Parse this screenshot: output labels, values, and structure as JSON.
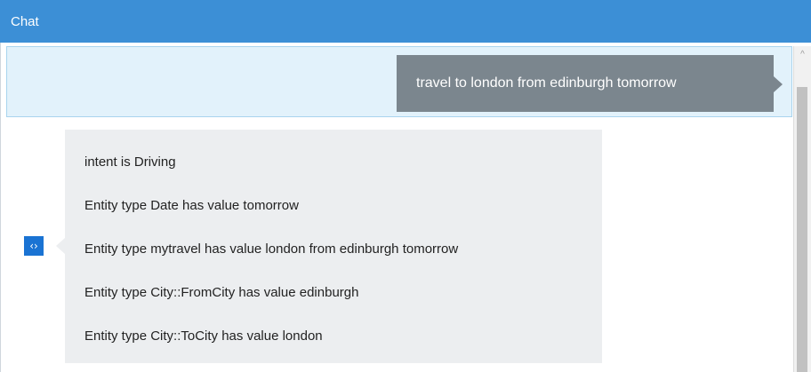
{
  "window": {
    "title": "Chat"
  },
  "conversation": {
    "user_message": "travel to london from edinburgh tomorrow",
    "bot_lines": [
      "intent is Driving",
      "Entity type Date has value tomorrow",
      "Entity type mytravel has value london from edinburgh tomorrow",
      "Entity type City::FromCity has value edinburgh",
      "Entity type City::ToCity has value london"
    ],
    "bot_avatar_glyph": "‹›"
  },
  "scrollbar": {
    "up_arrow_glyph": "^"
  },
  "colors": {
    "titlebar": "#3c8fd6",
    "user_row_bg": "#e2f2fb",
    "user_bubble": "#7b868e",
    "bot_bubble": "#eceef0",
    "bot_avatar": "#1a73d3"
  },
  "icons": {
    "bot_avatar": "code-brackets-icon",
    "scroll_up": "chevron-up-icon"
  }
}
